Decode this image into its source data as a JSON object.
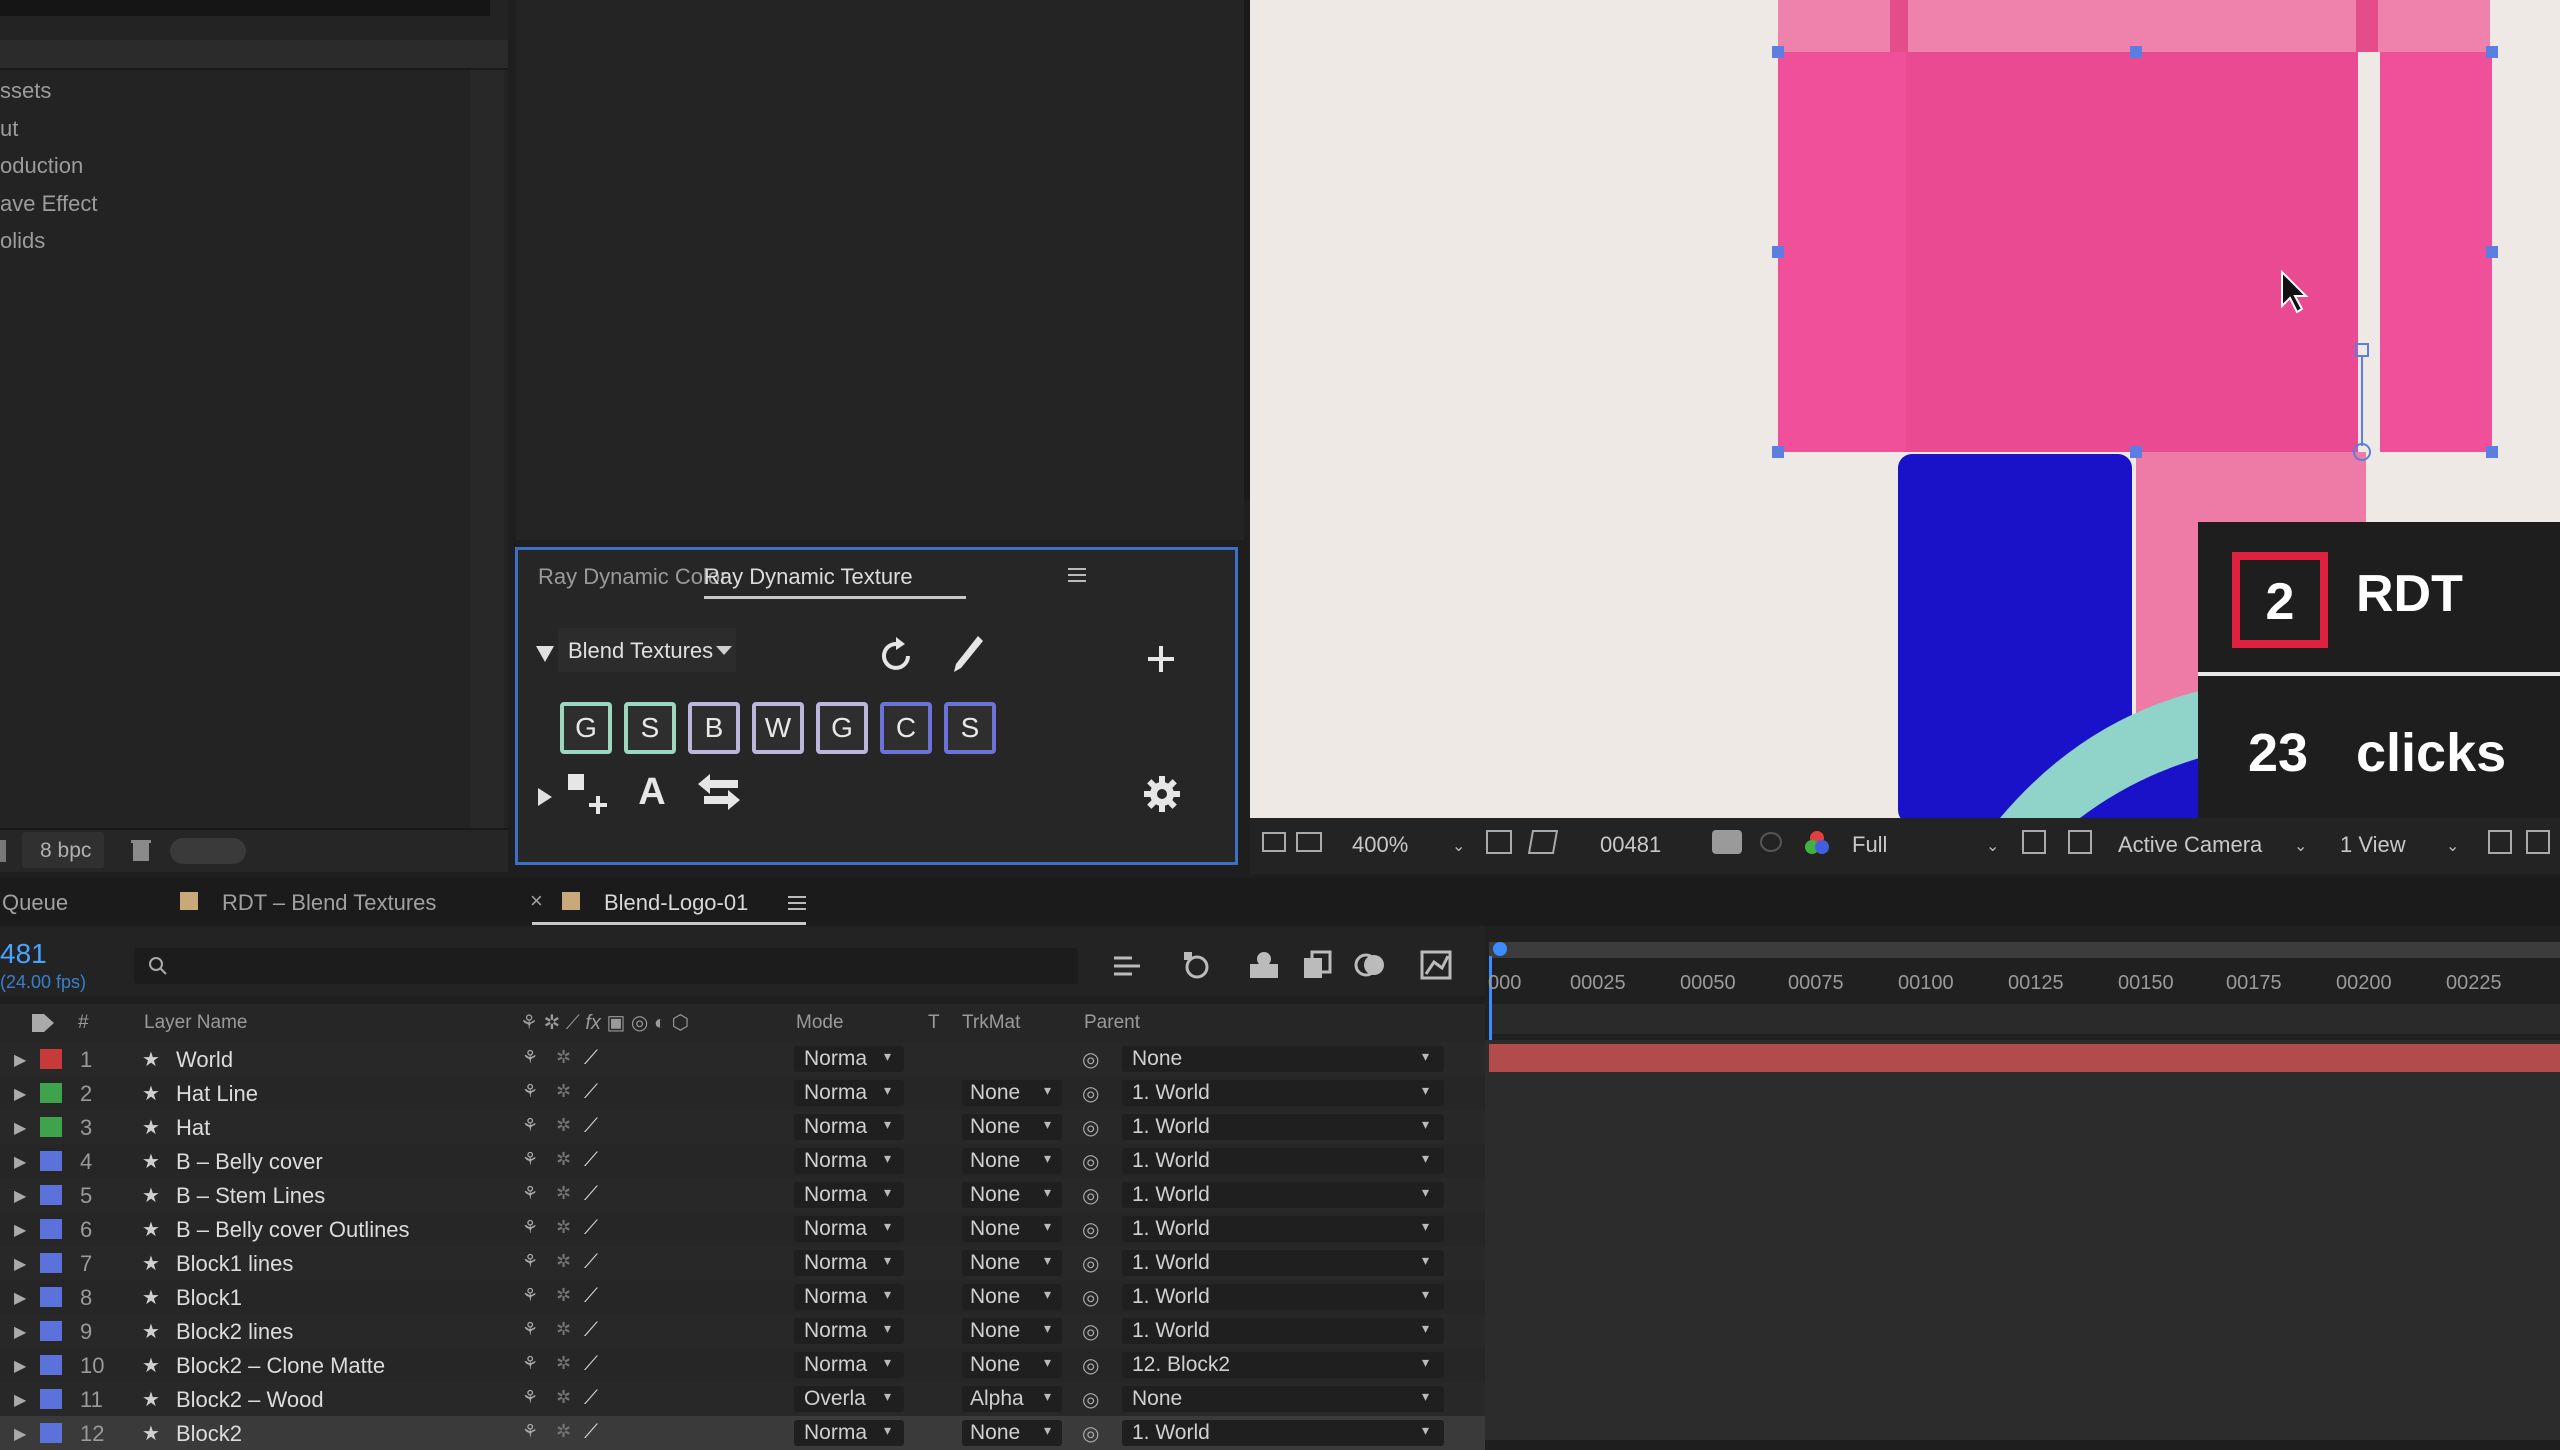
{
  "project_panel": {
    "items": [
      "ssets",
      "ut",
      "oduction",
      "ave Effect",
      "olids"
    ],
    "bpc_label": "8 bpc"
  },
  "rdt_panel": {
    "tabs": [
      "Ray Dynamic Color",
      "Ray Dynamic Texture"
    ],
    "active_tab": "Ray Dynamic Texture",
    "blend_dropdown": "Blend Textures",
    "letter_buttons": [
      "G",
      "S",
      "B",
      "W",
      "G",
      "C",
      "S"
    ],
    "text_tool": "A"
  },
  "overlay": {
    "badge_number": "2",
    "badge_text": "RDT",
    "clicks_count": "23",
    "clicks_label": "clicks"
  },
  "viewer_bar": {
    "zoom": "400%",
    "timecode": "00481",
    "resolution": "Full",
    "camera": "Active Camera",
    "view": "1 View"
  },
  "timeline_tabs": {
    "queue": "Queue",
    "comp1": "RDT – Blend Textures",
    "comp2": "Blend-Logo-01"
  },
  "timeline": {
    "current_frame": "481",
    "fps": "(24.00 fps)",
    "columns": {
      "num": "#",
      "layer_name": "Layer Name",
      "mode": "Mode",
      "t": "T",
      "trkmat": "TrkMat",
      "parent": "Parent"
    },
    "ruler_ticks": [
      "000",
      "00025",
      "00050",
      "00075",
      "00100",
      "00125",
      "00150",
      "00175",
      "00200",
      "00225"
    ],
    "layers": [
      {
        "num": "1",
        "name": "World",
        "color": "#c73a3a",
        "mode": "Norma",
        "trkmat": "",
        "parent": "None"
      },
      {
        "num": "2",
        "name": "Hat Line",
        "color": "#3fa34d",
        "mode": "Norma",
        "trkmat": "None",
        "parent": "1. World"
      },
      {
        "num": "3",
        "name": "Hat",
        "color": "#3fa34d",
        "mode": "Norma",
        "trkmat": "None",
        "parent": "1. World"
      },
      {
        "num": "4",
        "name": "B – Belly cover",
        "color": "#5a72d9",
        "mode": "Norma",
        "trkmat": "None",
        "parent": "1. World"
      },
      {
        "num": "5",
        "name": "B – Stem Lines",
        "color": "#5a72d9",
        "mode": "Norma",
        "trkmat": "None",
        "parent": "1. World"
      },
      {
        "num": "6",
        "name": "B – Belly cover Outlines",
        "color": "#5a72d9",
        "mode": "Norma",
        "trkmat": "None",
        "parent": "1. World"
      },
      {
        "num": "7",
        "name": "Block1 lines",
        "color": "#5a72d9",
        "mode": "Norma",
        "trkmat": "None",
        "parent": "1. World"
      },
      {
        "num": "8",
        "name": "Block1",
        "color": "#5a72d9",
        "mode": "Norma",
        "trkmat": "None",
        "parent": "1. World"
      },
      {
        "num": "9",
        "name": "Block2 lines",
        "color": "#5a72d9",
        "mode": "Norma",
        "trkmat": "None",
        "parent": "1. World"
      },
      {
        "num": "10",
        "name": "Block2 – Clone Matte",
        "color": "#5a72d9",
        "mode": "Norma",
        "trkmat": "None",
        "parent": "12. Block2"
      },
      {
        "num": "11",
        "name": "Block2 – Wood",
        "color": "#5a72d9",
        "mode": "Overla",
        "trkmat": "Alpha",
        "parent": "None"
      },
      {
        "num": "12",
        "name": "Block2",
        "color": "#5a72d9",
        "mode": "Norma",
        "trkmat": "None",
        "parent": "1. World"
      }
    ]
  },
  "colors": {
    "accent": "#3d6fc4",
    "pink": "#f0509a",
    "blue": "#1a12c8",
    "teal": "#8fd3c9",
    "red": "#e0203f"
  }
}
